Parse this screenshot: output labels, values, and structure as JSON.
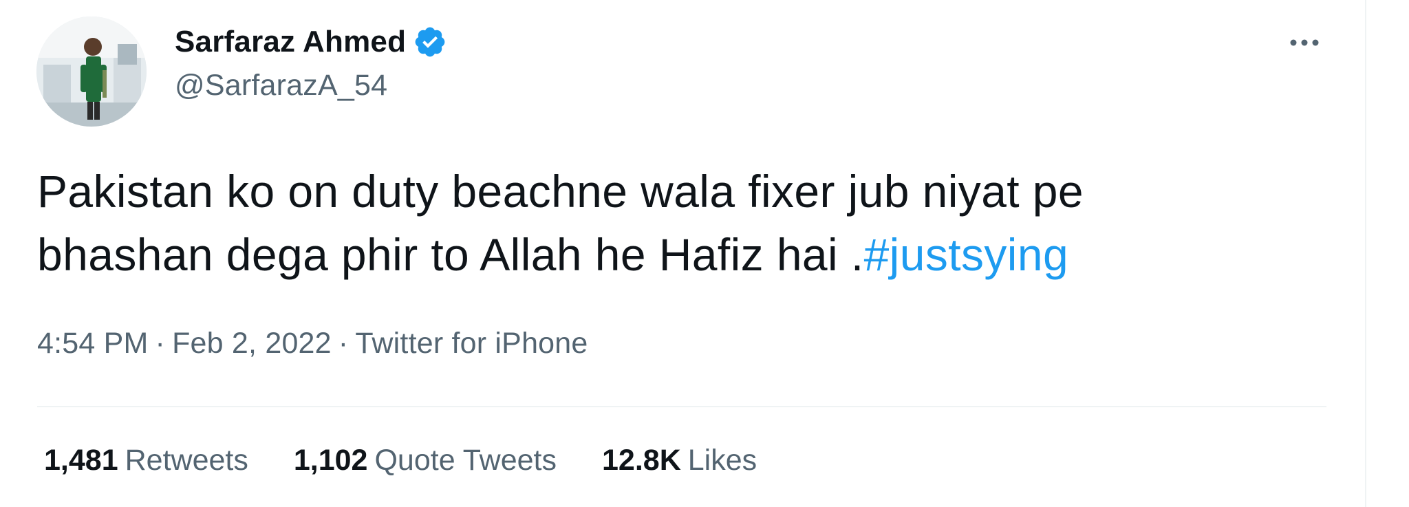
{
  "tweet": {
    "author": {
      "display_name": "Sarfaraz Ahmed",
      "handle": "@SarfarazA_54",
      "verified": true,
      "verified_icon": "verified-badge-icon"
    },
    "more_icon": "more-options-icon",
    "text": {
      "line1": "Pakistan ko on duty beachne wala fixer jub niyat pe",
      "line2": "bhashan dega phir to Allah he Hafiz hai .",
      "hashtag": "#justsying"
    },
    "meta": {
      "time": "4:54 PM",
      "separator": "·",
      "date": "Feb 2, 2022",
      "source": "Twitter for iPhone"
    },
    "stats": {
      "retweets": {
        "count": "1,481",
        "label": "Retweets"
      },
      "quote_tweets": {
        "count": "1,102",
        "label": "Quote Tweets"
      },
      "likes": {
        "count": "12.8K",
        "label": "Likes"
      }
    }
  },
  "colors": {
    "text_primary": "#0f1419",
    "text_secondary": "#536471",
    "accent": "#1d9bf0",
    "divider": "#eff3f4"
  }
}
